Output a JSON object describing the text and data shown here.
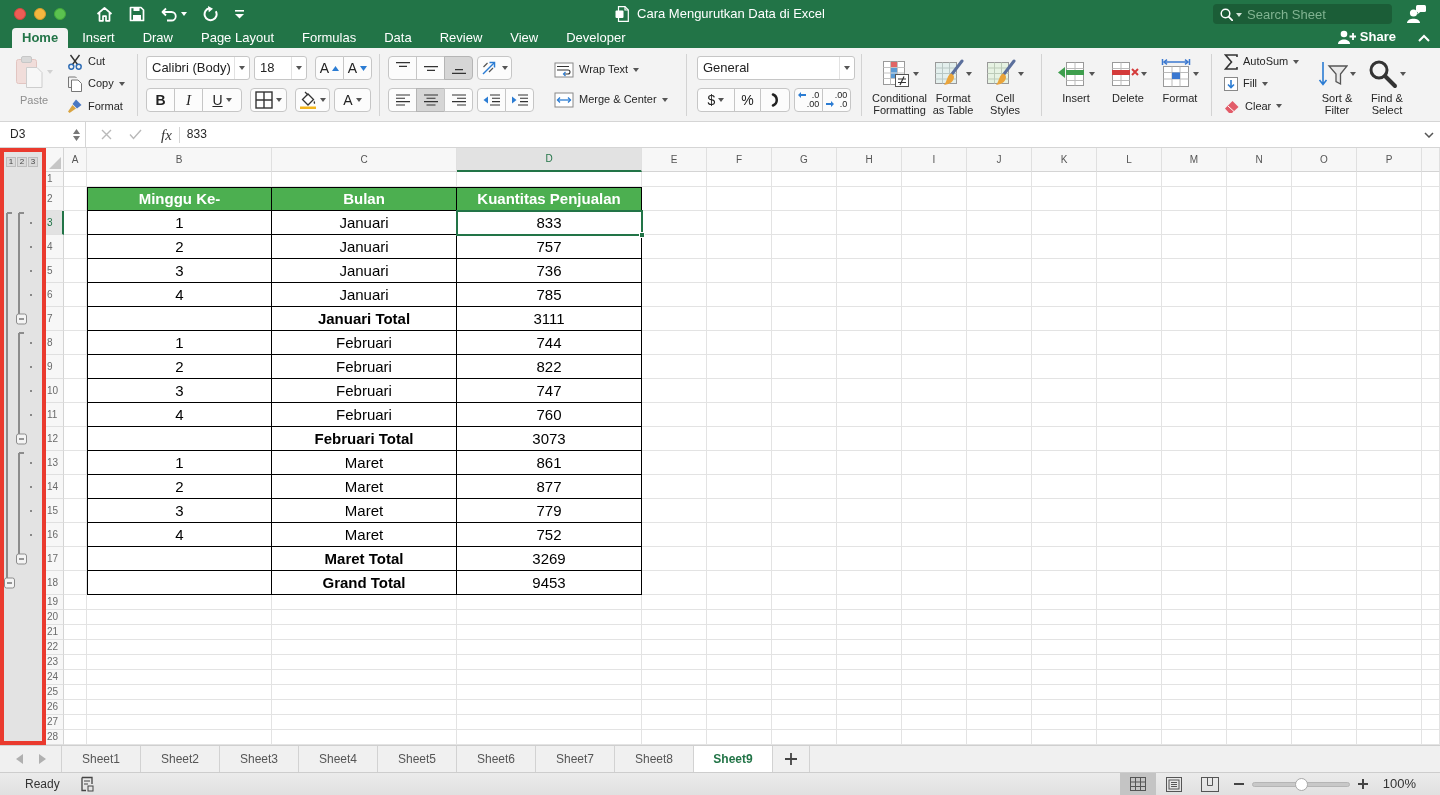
{
  "title_bar": {
    "title": "Cara Mengurutkan Data di Excel",
    "search": {
      "placeholder": "Search Sheet"
    }
  },
  "ribbon_tabs": [
    {
      "label": "Home",
      "selected": true
    },
    {
      "label": "Insert",
      "selected": false
    },
    {
      "label": "Draw",
      "selected": false
    },
    {
      "label": "Page Layout",
      "selected": false
    },
    {
      "label": "Formulas",
      "selected": false
    },
    {
      "label": "Data",
      "selected": false
    },
    {
      "label": "Review",
      "selected": false
    },
    {
      "label": "View",
      "selected": false
    },
    {
      "label": "Developer",
      "selected": false
    }
  ],
  "share": {
    "label": "Share"
  },
  "clipboard": {
    "paste": {
      "label": "Paste",
      "disabled": true
    },
    "items": [
      {
        "label": "Cut",
        "dropdown": false
      },
      {
        "label": "Copy",
        "dropdown": true
      },
      {
        "label": "Format",
        "dropdown": false
      }
    ]
  },
  "font": {
    "name": "Calibri (Body)",
    "size": "18",
    "size_buttons": [
      {
        "label": "A"
      },
      {
        "label": "A"
      }
    ],
    "style_buttons": [
      {
        "label": "B"
      },
      {
        "label": "I"
      },
      {
        "label": "U"
      }
    ],
    "color_button": {
      "label": "A"
    }
  },
  "alignment": {
    "vertical": [
      {
        "selected": false
      },
      {
        "selected": false
      },
      {
        "selected": true
      }
    ],
    "horizontal": [
      {
        "selected": false
      },
      {
        "selected": true
      },
      {
        "selected": false
      }
    ],
    "wrap_text": {
      "label": "Wrap Text"
    },
    "merge": {
      "label": "Merge & Center"
    }
  },
  "number": {
    "format": "General",
    "currency": "$",
    "percent": "%",
    "decimals": [
      {
        "top": ".0",
        "bottom": ".00"
      },
      {
        "top": ".00",
        "bottom": ".0"
      }
    ]
  },
  "styles": [
    {
      "label": "Conditional\nFormatting"
    },
    {
      "label": "Format\nas Table"
    },
    {
      "label": "Cell\nStyles"
    }
  ],
  "cells": [
    {
      "label": "Insert"
    },
    {
      "label": "Delete"
    },
    {
      "label": "Format"
    }
  ],
  "editing": {
    "items": [
      {
        "label": "AutoSum"
      },
      {
        "label": "Fill"
      },
      {
        "label": "Clear"
      }
    ],
    "buttons": [
      {
        "label": "Sort &\nFilter"
      },
      {
        "label": "Find &\nSelect"
      }
    ]
  },
  "formula_bar": {
    "name_box": "D3",
    "function_label": "fx",
    "formula": "833"
  },
  "outline": {
    "highlighted": true,
    "level_buttons": [
      "1",
      "2",
      "3"
    ],
    "groups": [
      {
        "expanded": true,
        "children": [
          {
            "expanded": true
          },
          {
            "expanded": true
          },
          {
            "expanded": true
          }
        ]
      }
    ]
  },
  "column_headers": [
    {
      "label": "A",
      "selected": false
    },
    {
      "label": "B",
      "selected": false
    },
    {
      "label": "C",
      "selected": false
    },
    {
      "label": "D",
      "selected": true
    },
    {
      "label": "E",
      "selected": false
    },
    {
      "label": "F",
      "selected": false
    },
    {
      "label": "G",
      "selected": false
    },
    {
      "label": "H",
      "selected": false
    },
    {
      "label": "I",
      "selected": false
    },
    {
      "label": "J",
      "selected": false
    },
    {
      "label": "K",
      "selected": false
    },
    {
      "label": "L",
      "selected": false
    },
    {
      "label": "M",
      "selected": false
    },
    {
      "label": "N",
      "selected": false
    },
    {
      "label": "O",
      "selected": false
    },
    {
      "label": "P",
      "selected": false
    }
  ],
  "row_headers": [
    {
      "label": "1",
      "selected": false
    },
    {
      "label": "2",
      "selected": false
    },
    {
      "label": "3",
      "selected": true
    },
    {
      "label": "4",
      "selected": false
    },
    {
      "label": "5",
      "selected": false
    },
    {
      "label": "6",
      "selected": false
    },
    {
      "label": "7",
      "selected": false
    },
    {
      "label": "8",
      "selected": false
    },
    {
      "label": "9",
      "selected": false
    },
    {
      "label": "10",
      "selected": false
    },
    {
      "label": "11",
      "selected": false
    },
    {
      "label": "12",
      "selected": false
    },
    {
      "label": "13",
      "selected": false
    },
    {
      "label": "14",
      "selected": false
    },
    {
      "label": "15",
      "selected": false
    },
    {
      "label": "16",
      "selected": false
    },
    {
      "label": "17",
      "selected": false
    },
    {
      "label": "18",
      "selected": false
    },
    {
      "label": "19",
      "selected": false
    },
    {
      "label": "20",
      "selected": false
    },
    {
      "label": "21",
      "selected": false
    },
    {
      "label": "22",
      "selected": false
    },
    {
      "label": "23",
      "selected": false
    },
    {
      "label": "24",
      "selected": false
    },
    {
      "label": "25",
      "selected": false
    },
    {
      "label": "26",
      "selected": false
    },
    {
      "label": "27",
      "selected": false
    },
    {
      "label": "28",
      "selected": false
    }
  ],
  "table": {
    "columns": [
      "Minggu Ke-",
      "Bulan",
      "Kuantitas Penjualan"
    ],
    "rows": [
      {
        "kind": "detail",
        "cells": [
          "1",
          "Januari",
          "833"
        ]
      },
      {
        "kind": "detail",
        "cells": [
          "2",
          "Januari",
          "757"
        ]
      },
      {
        "kind": "detail",
        "cells": [
          "3",
          "Januari",
          "736"
        ]
      },
      {
        "kind": "detail",
        "cells": [
          "4",
          "Januari",
          "785"
        ]
      },
      {
        "kind": "subtotal",
        "label": "Januari Total",
        "value": "3111"
      },
      {
        "kind": "detail",
        "cells": [
          "1",
          "Februari",
          "744"
        ]
      },
      {
        "kind": "detail",
        "cells": [
          "2",
          "Februari",
          "822"
        ]
      },
      {
        "kind": "detail",
        "cells": [
          "3",
          "Februari",
          "747"
        ]
      },
      {
        "kind": "detail",
        "cells": [
          "4",
          "Februari",
          "760"
        ]
      },
      {
        "kind": "subtotal",
        "label": "Februari Total",
        "value": "3073"
      },
      {
        "kind": "detail",
        "cells": [
          "1",
          "Maret",
          "861"
        ]
      },
      {
        "kind": "detail",
        "cells": [
          "2",
          "Maret",
          "877"
        ]
      },
      {
        "kind": "detail",
        "cells": [
          "3",
          "Maret",
          "779"
        ]
      },
      {
        "kind": "detail",
        "cells": [
          "4",
          "Maret",
          "752"
        ]
      },
      {
        "kind": "subtotal",
        "label": "Maret Total",
        "value": "3269"
      },
      {
        "kind": "total",
        "label": "Grand Total",
        "value": "9453"
      }
    ]
  },
  "sheet_tabs": [
    {
      "label": "Sheet1",
      "selected": false
    },
    {
      "label": "Sheet2",
      "selected": false
    },
    {
      "label": "Sheet3",
      "selected": false
    },
    {
      "label": "Sheet4",
      "selected": false
    },
    {
      "label": "Sheet5",
      "selected": false
    },
    {
      "label": "Sheet6",
      "selected": false
    },
    {
      "label": "Sheet7",
      "selected": false
    },
    {
      "label": "Sheet8",
      "selected": false
    },
    {
      "label": "Sheet9",
      "selected": true
    }
  ],
  "status_bar": {
    "status": "Ready",
    "views": [
      {
        "selected": true
      },
      {
        "selected": false
      },
      {
        "selected": false
      }
    ],
    "zoom": {
      "level": 0.5,
      "reading": "100%"
    }
  }
}
